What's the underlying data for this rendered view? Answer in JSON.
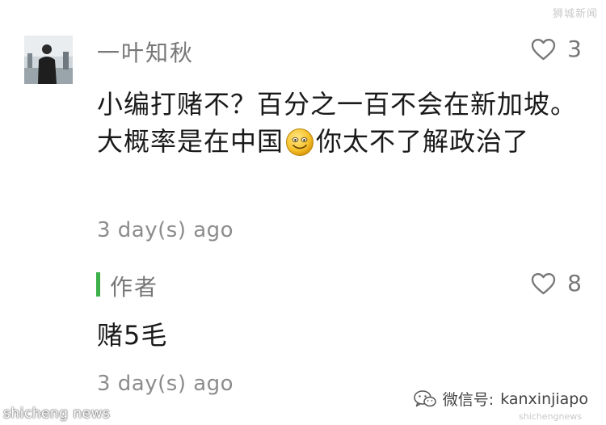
{
  "watermark": {
    "top": "狮城新闻",
    "bottom_left": "shicheng news",
    "bottom_right_prefix": "微信号: ",
    "bottom_right_id": "kanxinjiapo",
    "bottom_right_sub": "shichengnews"
  },
  "comment": {
    "username": "一叶知秋",
    "likes": "3",
    "text_part1": "小编打赌不？百分之一百不会在新加坡。大概率是在中国",
    "emoji": "smile-emoji",
    "text_part2": "你太不了解政治了",
    "timestamp": "3 day(s) ago"
  },
  "reply": {
    "author": "作者",
    "likes": "8",
    "text": "赌5毛",
    "timestamp": "3 day(s) ago"
  },
  "icons": {
    "like": "heart-outline-icon",
    "wechat": "wechat-icon"
  },
  "colors": {
    "author_bar": "#3db04a",
    "muted_text": "#777777",
    "body_text": "#1a1a1a"
  }
}
